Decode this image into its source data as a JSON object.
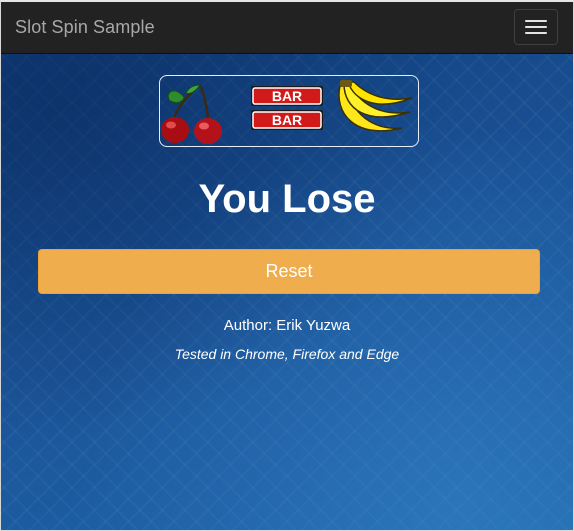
{
  "navbar": {
    "brand": "Slot Spin Sample",
    "menu_icon": "hamburger-icon"
  },
  "reels": {
    "symbols": [
      {
        "name": "cherry",
        "icon": "cherries-icon"
      },
      {
        "name": "bar",
        "icon": "double-bar-icon",
        "label_top": "BAR",
        "label_bottom": "BAR"
      },
      {
        "name": "banana",
        "icon": "bananas-icon"
      }
    ]
  },
  "result": {
    "message": "You Lose"
  },
  "actions": {
    "reset_label": "Reset"
  },
  "footer": {
    "author": "Author: Erik Yuzwa",
    "tested": "Tested in Chrome, Firefox and Edge"
  },
  "colors": {
    "navbar": "#222222",
    "background": "#1c4f8f",
    "reset_button": "#f0ad4e",
    "text": "#ffffff",
    "brand_text": "#a8a8a8"
  }
}
